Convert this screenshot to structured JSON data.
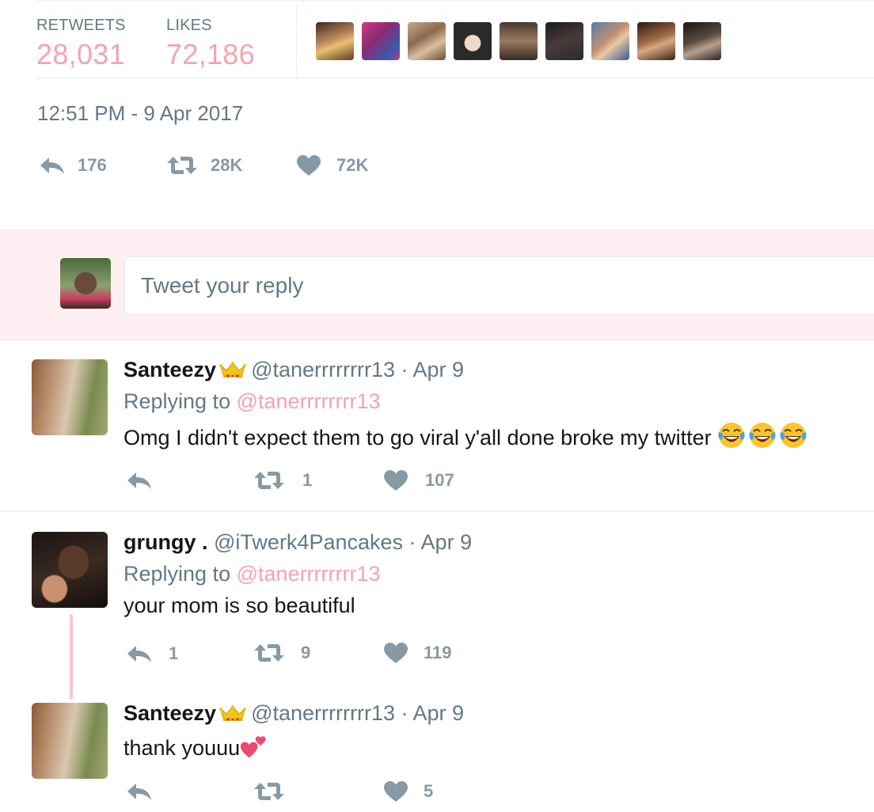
{
  "stats": {
    "retweets_label": "RETWEETS",
    "retweets_value": "28,031",
    "likes_label": "LIKES",
    "likes_value": "72,186"
  },
  "timestamp": "12:51 PM - 9 Apr 2017",
  "main_actions": {
    "reply_count": "176",
    "retweet_count": "28K",
    "like_count": "72K"
  },
  "composer": {
    "placeholder": "Tweet your reply"
  },
  "replies": [
    {
      "name": "Santeezy",
      "handle": "@tanerrrrrrrr13",
      "date": "· Apr 9",
      "replying_label": "Replying to",
      "replying_to": "@tanerrrrrrrr13",
      "text": "Omg I didn't expect them to go viral y'all done broke my twitter",
      "reply_count": "",
      "retweet_count": "1",
      "like_count": "107"
    },
    {
      "name": "grungy .",
      "handle": "@iTwerk4Pancakes",
      "date": "· Apr 9",
      "replying_label": "Replying to",
      "replying_to": "@tanerrrrrrrr13",
      "text": "your mom is so beautiful",
      "reply_count": "1",
      "retweet_count": "9",
      "like_count": "119"
    },
    {
      "name": "Santeezy",
      "handle": "@tanerrrrrrrr13",
      "date": "· Apr 9",
      "text": "thank youuu",
      "reply_count": "",
      "retweet_count": "",
      "like_count": "5"
    }
  ],
  "colors": {
    "accent": "#f4a3b3",
    "muted": "#657786",
    "icon": "#8899a6",
    "composer_bg": "#fef0f2"
  }
}
